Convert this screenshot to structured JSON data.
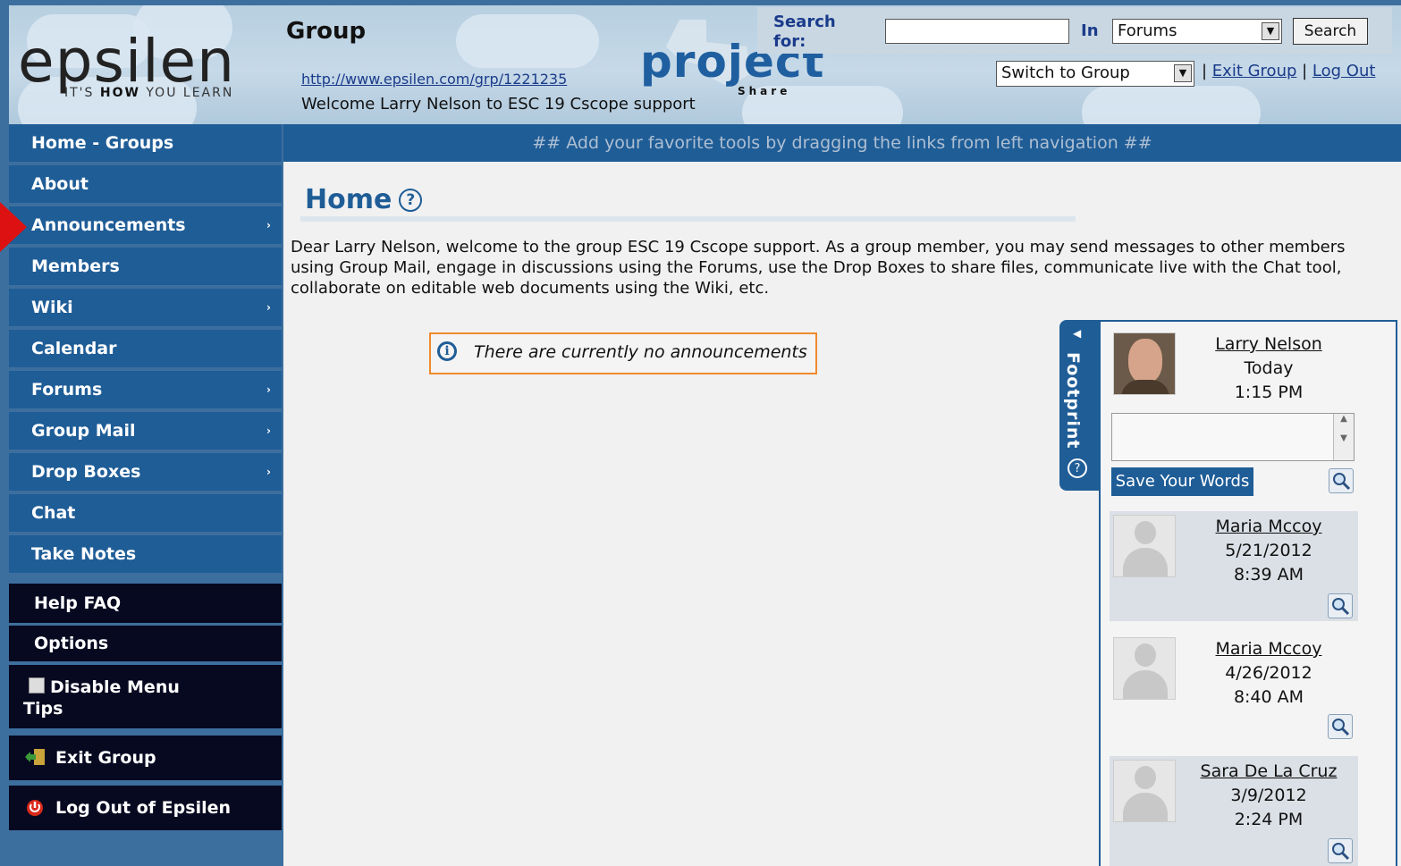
{
  "header": {
    "logo_text": "epsilen",
    "logo_tagline_pre": "IT'S ",
    "logo_tagline_bold": "HOW",
    "logo_tagline_post": " YOU LEARN",
    "group_title": "Group",
    "group_url": "http://www.epsilen.com/grp/1221235",
    "welcome": "Welcome Larry Nelson to ESC 19 Cscope support",
    "project_logo": "project",
    "project_logo_sub": "Share",
    "search_label": "Search for:",
    "search_value": "",
    "in_label": "In",
    "in_selected": "Forums",
    "search_button": "Search",
    "switch_selected": "Switch to Group",
    "sep1": " | ",
    "exit_group": "Exit Group",
    "sep2": " | ",
    "log_out": "Log Out"
  },
  "tool_bar": "## Add your favorite tools by dragging the links from left navigation ##",
  "nav": {
    "items": [
      {
        "label": "Home - Groups",
        "arrow": ""
      },
      {
        "label": "About",
        "arrow": ""
      },
      {
        "label": "Announcements",
        "arrow": "›"
      },
      {
        "label": "Members",
        "arrow": ""
      },
      {
        "label": "Wiki",
        "arrow": "›"
      },
      {
        "label": "Calendar",
        "arrow": ""
      },
      {
        "label": "Forums",
        "arrow": "›"
      },
      {
        "label": "Group Mail",
        "arrow": "›"
      },
      {
        "label": "Drop Boxes",
        "arrow": "›"
      },
      {
        "label": "Chat",
        "arrow": ""
      },
      {
        "label": "Take Notes",
        "arrow": ""
      }
    ],
    "help_faq": "Help FAQ",
    "options": "Options",
    "disable_tips_1": "Disable Menu",
    "disable_tips_2": "Tips",
    "exit_group": "Exit Group",
    "log_out": "Log Out of Epsilen"
  },
  "main": {
    "title": "Home",
    "help_glyph": "?",
    "welcome_text": "Dear Larry Nelson, welcome to the group ESC 19 Cscope support. As a group member, you may send messages to other members using Group Mail, engage in discussions using the Forums, use the Drop Boxes to share files, communicate live with the Chat tool, collaborate on editable web documents using the Wiki, etc.",
    "announcement_icon": "i",
    "announcement_text": "There are currently no announcements"
  },
  "footprint": {
    "tab_label": "Footprint",
    "save_button": "Save Your Words",
    "words_value": "",
    "entries": [
      {
        "name": "Larry Nelson",
        "date": "Today",
        "time": "1:15 PM"
      },
      {
        "name": "Maria Mccoy",
        "date": "5/21/2012",
        "time": "8:39 AM"
      },
      {
        "name": "Maria Mccoy",
        "date": "4/26/2012",
        "time": "8:40 AM"
      },
      {
        "name": "Sara De La Cruz",
        "date": "3/9/2012",
        "time": "2:24 PM"
      }
    ]
  },
  "icons": {
    "announcement_info": "info-icon",
    "help": "help-icon",
    "zoom": "magnifier-icon",
    "exit": "exit-door-icon",
    "logout": "power-icon",
    "checkbox": "checkbox-icon"
  },
  "colors": {
    "nav_blue": "#1f5d97",
    "nav_dark": "#060920",
    "announce_border": "#f08a2c",
    "pointer_red": "#dd1111"
  }
}
